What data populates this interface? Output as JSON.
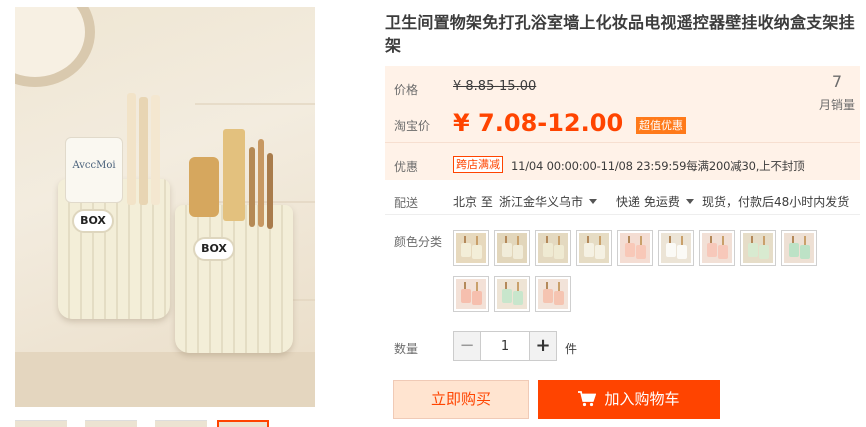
{
  "product": {
    "title": "卫生间置物架免打孔浴室墙上化妆品电视遥控器壁挂收纳盒支架挂架",
    "image_brand_text": "BOX",
    "image_tube_text": "AvccMoi"
  },
  "price": {
    "label": "价格",
    "original": "¥ 8.85-15.00",
    "taobao_label": "淘宝价",
    "current": "¥ 7.08-12.00",
    "super_tag": "超值优惠"
  },
  "monthly_sales": {
    "count": "7",
    "label": "月销量"
  },
  "promo": {
    "label": "优惠",
    "tag": "跨店满减",
    "text": "11/04 00:00:00-11/08 23:59:59每满200减30,上不封顶"
  },
  "delivery": {
    "label": "配送",
    "from": "北京 至",
    "to": "浙江金华义乌市",
    "shipping": "快递 免运费",
    "stock": "现货，付款后48小时内发货"
  },
  "colors": {
    "label": "颜色分类",
    "options": [
      {
        "tone": "#e7d9bd",
        "cup": "#f3eed8"
      },
      {
        "tone": "#e2d6bb",
        "cup": "#f1ecd9"
      },
      {
        "tone": "#e4d9c0",
        "cup": "#efead2"
      },
      {
        "tone": "#e6dcc4",
        "cup": "#f5f1e3"
      },
      {
        "tone": "#f4ddd3",
        "cup": "#f8c8b8"
      },
      {
        "tone": "#ece4d6",
        "cup": "#fbfaf6"
      },
      {
        "tone": "#f2e0d6",
        "cup": "#f7c8ba"
      },
      {
        "tone": "#e6ddc8",
        "cup": "#d8ead0"
      },
      {
        "tone": "#eee0d4",
        "cup": "#bde2c6"
      },
      {
        "tone": "#f3e1d7",
        "cup": "#f6bfae"
      },
      {
        "tone": "#eee4d5",
        "cup": "#c8e6cc"
      },
      {
        "tone": "#f2e3d9",
        "cup": "#f5c4b1"
      }
    ]
  },
  "quantity": {
    "label": "数量",
    "value": "1",
    "unit": "件",
    "minus": "−",
    "plus": "+"
  },
  "actions": {
    "buy_now": "立即购买",
    "add_to_cart": "加入购物车"
  },
  "colors_accent": {
    "primary": "#ff4400",
    "super_tag": "#ff7a1a",
    "price_bg": "#fff2e8"
  }
}
